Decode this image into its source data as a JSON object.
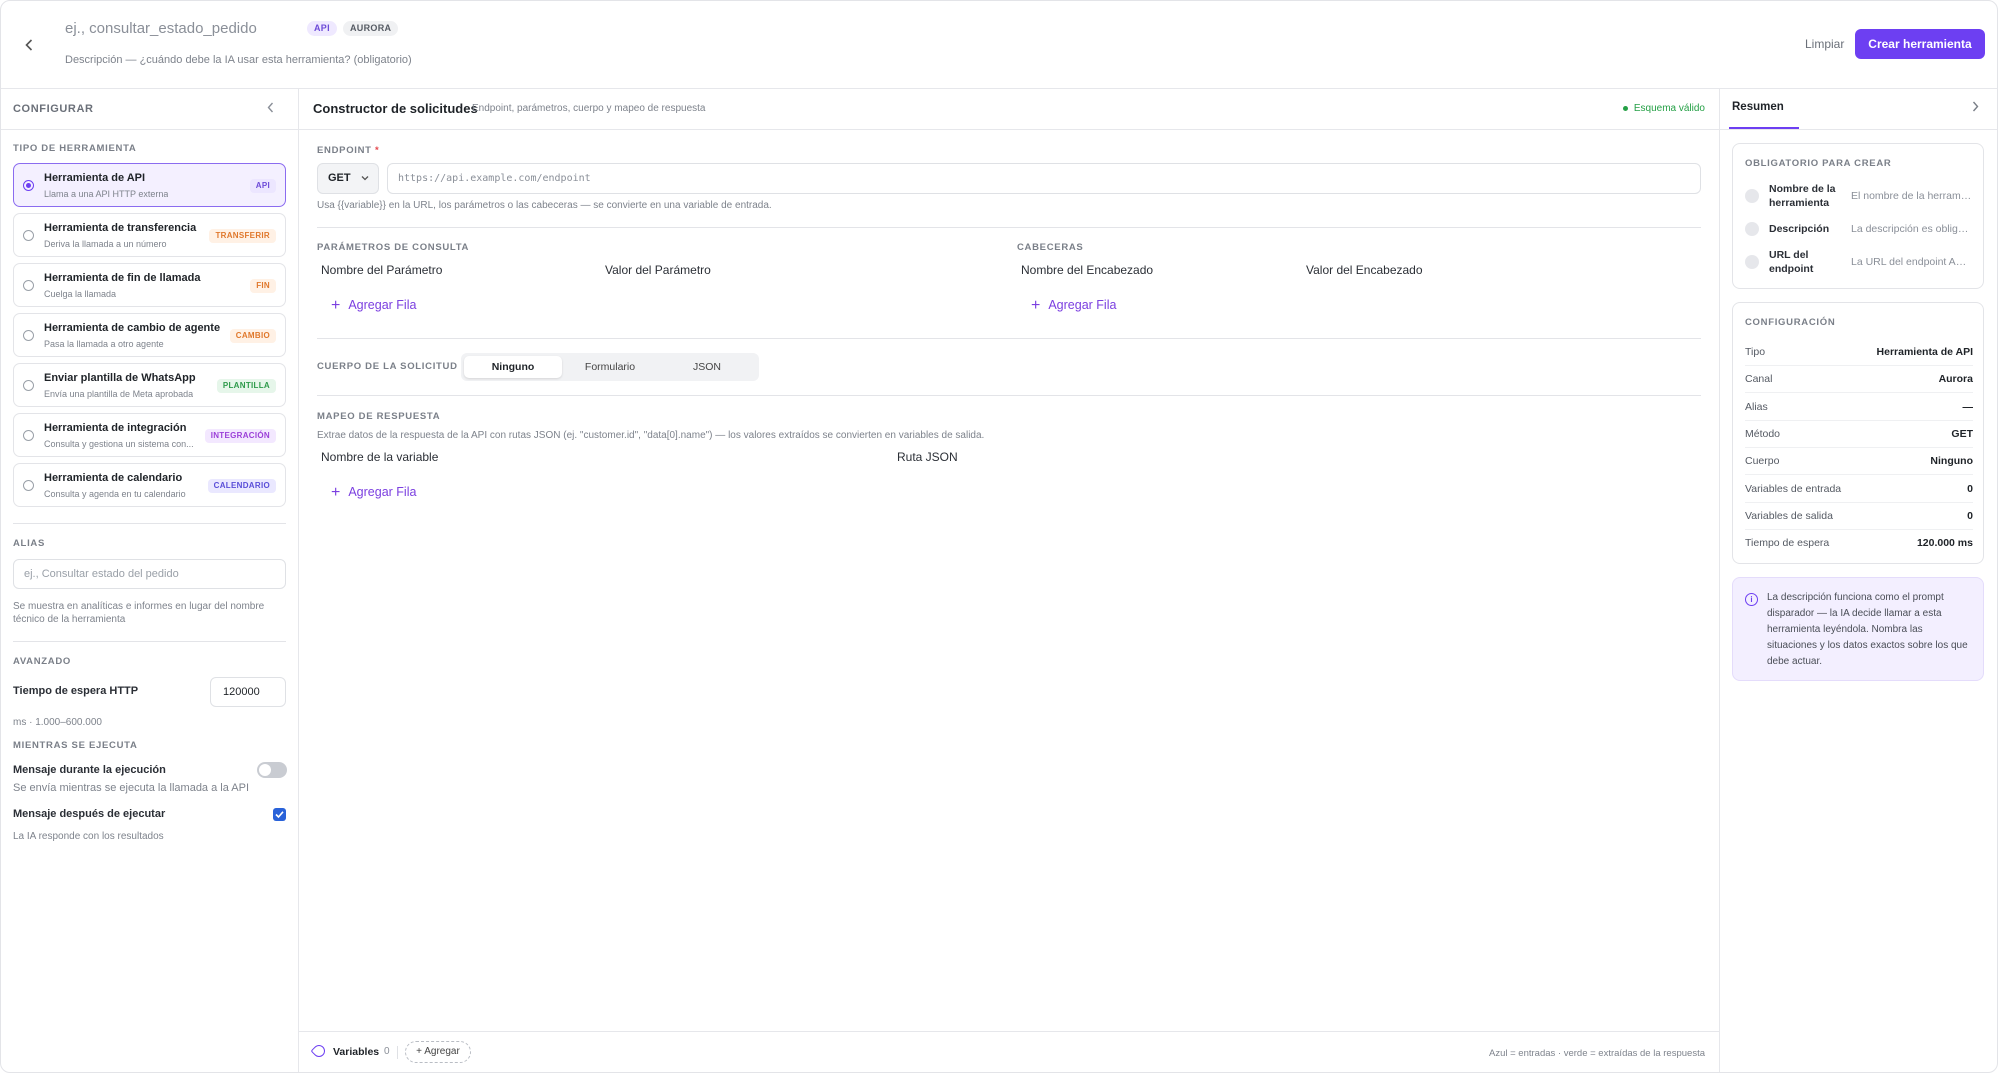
{
  "header": {
    "title_placeholder": "ej., consultar_estado_pedido",
    "badges": [
      "API",
      "AURORA"
    ],
    "description_placeholder": "Descripción — ¿cuándo debe la IA usar esta herramienta? (obligatorio)",
    "clear_label": "Limpiar",
    "create_label": "Crear herramienta"
  },
  "left": {
    "title": "CONFIGURAR",
    "tool_type_label": "TIPO DE HERRAMIENTA",
    "tools": [
      {
        "title": "Herramienta de API",
        "subtitle": "Llama a una API HTTP externa",
        "tag": "API",
        "tag_bg": "#ece6ff",
        "tag_fg": "#6d4bd8",
        "selected": true
      },
      {
        "title": "Herramienta de transferencia",
        "subtitle": "Deriva la llamada a un número",
        "tag": "TRANSFERIR",
        "tag_bg": "#fff1e5",
        "tag_fg": "#e0782c",
        "selected": false
      },
      {
        "title": "Herramienta de fin de llamada",
        "subtitle": "Cuelga la llamada",
        "tag": "FIN",
        "tag_bg": "#fff1e5",
        "tag_fg": "#e0782c",
        "selected": false
      },
      {
        "title": "Herramienta de cambio de agente",
        "subtitle": "Pasa la llamada a otro agente",
        "tag": "CAMBIO",
        "tag_bg": "#fff1e5",
        "tag_fg": "#e0782c",
        "selected": false
      },
      {
        "title": "Enviar plantilla de WhatsApp",
        "subtitle": "Envía una plantilla de Meta aprobada",
        "tag": "PLANTILLA",
        "tag_bg": "#e6f6ea",
        "tag_fg": "#2e9a4b",
        "selected": false
      },
      {
        "title": "Herramienta de integración",
        "subtitle": "Consulta y gestiona un sistema con...",
        "tag": "INTEGRACIÓN",
        "tag_bg": "#f3e8ff",
        "tag_fg": "#9b3fd8",
        "selected": false
      },
      {
        "title": "Herramienta de calendario",
        "subtitle": "Consulta y agenda en tu calendario",
        "tag": "CALENDARIO",
        "tag_bg": "#eae8ff",
        "tag_fg": "#5a4ed8",
        "selected": false
      }
    ],
    "alias_label": "ALIAS",
    "alias_placeholder": "ej., Consultar estado del pedido",
    "alias_help": "Se muestra en analíticas e informes en lugar del nombre técnico de la herramienta",
    "advanced_label": "AVANZADO",
    "timeout_label": "Tiempo de espera HTTP",
    "timeout_value": "120000",
    "timeout_help": "ms · 1.000–600.000",
    "while_running_label": "MIENTRAS SE EJECUTA",
    "msg_during_label": "Mensaje durante la ejecución",
    "msg_during_help": "Se envía mientras se ejecuta la llamada a la API",
    "msg_during_on": false,
    "msg_after_label": "Mensaje después de ejecutar",
    "msg_after_help": "La IA responde con los resultados",
    "msg_after_checked": true
  },
  "center": {
    "title": "Constructor de solicitudes",
    "subtitle": "Endpoint, parámetros, cuerpo y mapeo de respuesta",
    "valid_label": "Esquema válido",
    "endpoint_label": "ENDPOINT",
    "required_mark": "*",
    "method": "GET",
    "url_placeholder": "https://api.example.com/endpoint",
    "url_help": "Usa {{variable}} en la URL, los parámetros o las cabeceras — se convierte en una variable de entrada.",
    "query_label": "PARÁMETROS DE CONSULTA",
    "query_col_name": "Nombre del Parámetro",
    "query_col_value": "Valor del Parámetro",
    "headers_label": "CABECERAS",
    "headers_col_name": "Nombre del Encabezado",
    "headers_col_value": "Valor del Encabezado",
    "add_row_label": "Agregar Fila",
    "body_label": "CUERPO DE LA SOLICITUD",
    "body_options": [
      "Ninguno",
      "Formulario",
      "JSON"
    ],
    "body_selected": "Ninguno",
    "mapping_label": "MAPEO DE RESPUESTA",
    "mapping_help": "Extrae datos de la respuesta de la API con rutas JSON (ej. \"customer.id\", \"data[0].name\") — los valores extraídos se convierten en variables de salida.",
    "mapping_col_name": "Nombre de la variable",
    "mapping_col_path": "Ruta JSON",
    "footer_variables_label": "Variables",
    "footer_variables_count": "0",
    "footer_add_label": "+ Agregar",
    "footer_legend": "Azul = entradas · verde = extraídas de la respuesta"
  },
  "right": {
    "tab_label": "Resumen",
    "required_label": "OBLIGATORIO PARA CREAR",
    "required_items": [
      {
        "name": "Nombre de la herramienta",
        "value": "El nombre de la herramienta es obligatorio"
      },
      {
        "name": "Descripción",
        "value": "La descripción es obligatoria"
      },
      {
        "name": "URL del endpoint",
        "value": "La URL del endpoint API es obligatoria"
      }
    ],
    "config_label": "CONFIGURACIÓN",
    "config_rows": [
      {
        "key": "Tipo",
        "value": "Herramienta de API"
      },
      {
        "key": "Canal",
        "value": "Aurora"
      },
      {
        "key": "Alias",
        "value": "—"
      },
      {
        "key": "Método",
        "value": "GET"
      },
      {
        "key": "Cuerpo",
        "value": "Ninguno"
      },
      {
        "key": "Variables de entrada",
        "value": "0"
      },
      {
        "key": "Variables de salida",
        "value": "0"
      },
      {
        "key": "Tiempo de espera",
        "value": "120.000 ms"
      }
    ],
    "info_text": "La descripción funciona como el prompt disparador — la IA decide llamar a esta herramienta leyéndola. Nombra las situaciones y los datos exactos sobre los que debe actuar."
  },
  "icons": {
    "back": "chevron-left-icon",
    "collapse_left": "chevron-left-icon",
    "collapse_right": "chevron-right-icon",
    "method_dropdown": "chevron-down-icon",
    "add_row": "plus-icon",
    "variables": "tag-icon",
    "info": "info-icon",
    "valid": "status-dot-icon"
  },
  "colors": {
    "accent": "#6d3ff2",
    "valid": "#25a046",
    "checkbox": "#2962d9"
  }
}
